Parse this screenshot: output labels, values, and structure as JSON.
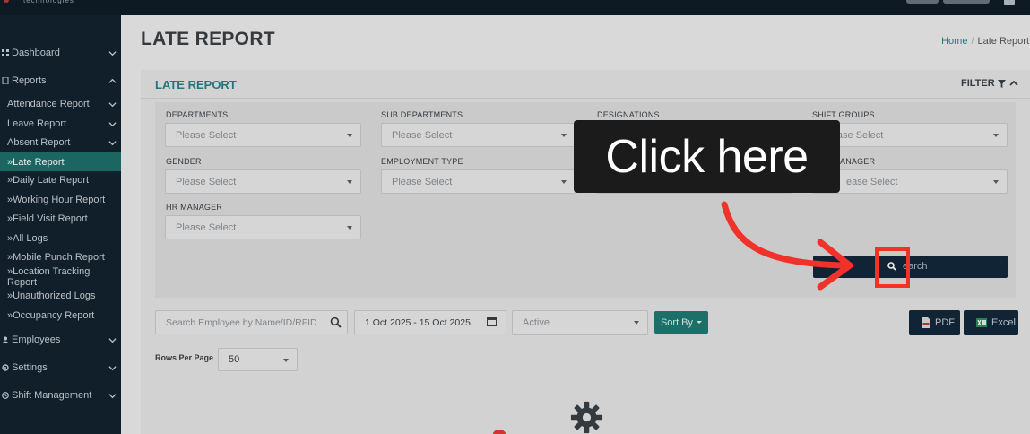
{
  "topbar": {
    "logo_text": "technologies"
  },
  "sidebar": {
    "items": [
      {
        "label": "Dashboard",
        "level": "top",
        "icon": "dashboard-icon",
        "chevron": "down"
      },
      {
        "label": "Reports",
        "level": "top",
        "icon": "reports-icon",
        "chevron": "up"
      },
      {
        "label": "Attendance Report",
        "level": "sub",
        "chevron": "down"
      },
      {
        "label": "Leave Report",
        "level": "sub",
        "chevron": "down"
      },
      {
        "label": "Absent Report",
        "level": "sub",
        "chevron": "down"
      },
      {
        "label": "»Late Report",
        "level": "leaf",
        "active": true
      },
      {
        "label": "»Daily Late Report",
        "level": "leaf"
      },
      {
        "label": "»Working Hour Report",
        "level": "leaf"
      },
      {
        "label": "»Field Visit Report",
        "level": "leaf"
      },
      {
        "label": "»All Logs",
        "level": "leaf"
      },
      {
        "label": "»Mobile Punch Report",
        "level": "leaf"
      },
      {
        "label": "»Location Tracking Report",
        "level": "leaf"
      },
      {
        "label": "»Unauthorized Logs",
        "level": "leaf"
      },
      {
        "label": "»Occupancy Report",
        "level": "leaf"
      },
      {
        "label": "Employees",
        "level": "top",
        "icon": "users-icon",
        "chevron": "down"
      },
      {
        "label": "Settings",
        "level": "top",
        "icon": "gear-icon",
        "chevron": "down"
      },
      {
        "label": "Shift Management",
        "level": "top",
        "icon": "clock-icon",
        "chevron": "down"
      }
    ]
  },
  "page": {
    "title": "LATE REPORT"
  },
  "breadcrumb": {
    "home": "Home",
    "separator": "/",
    "current": "Late Report"
  },
  "card": {
    "title": "LATE REPORT",
    "filter_label": "FILTER"
  },
  "filters": {
    "departments": {
      "label": "DEPARTMENTS",
      "placeholder": "Please Select"
    },
    "sub_departments": {
      "label": "SUB DEPARTMENTS",
      "placeholder": "Please Select"
    },
    "designations": {
      "label": "DESIGNATIONS"
    },
    "shift_groups": {
      "label": "SHIFT GROUPS",
      "placeholder": "Please Select"
    },
    "gender": {
      "label": "GENDER",
      "placeholder": "Please Select"
    },
    "employment_type": {
      "label": "EMPLOYMENT TYPE",
      "placeholder": "Please Select"
    },
    "manager": {
      "label": "ANAGER",
      "placeholder": "ease Select"
    },
    "hr_manager": {
      "label": "HR MANAGER",
      "placeholder": "Please Select"
    },
    "search_button": "earch"
  },
  "toolbar": {
    "employee_search_placeholder": "Search Employee by Name/ID/RFID",
    "date_range": "1 Oct 2025 - 15 Oct 2025",
    "status_value": "Active",
    "sort_by": "Sort By",
    "pdf": "PDF",
    "excel": "Excel",
    "rows_per_page_label": "Rows Per Page",
    "rows_per_page_value": "50"
  },
  "overlay": {
    "callout": "Click here"
  },
  "colors": {
    "accent_teal": "#2a7f88",
    "sidebar_bg": "#13222e",
    "sidebar_active": "#1f6f6a",
    "dark_button": "#13283a",
    "highlight_red": "#f0322a"
  }
}
